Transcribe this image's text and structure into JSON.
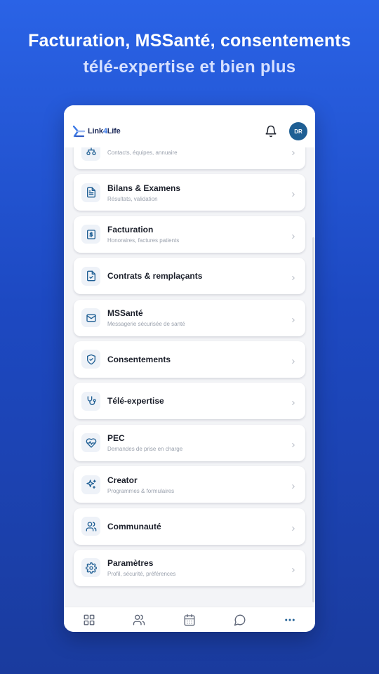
{
  "promo": {
    "headline": "Facturation, MSSanté, consentements",
    "subline": "télé-expertise et bien plus"
  },
  "app": {
    "logo_prefix": "Link",
    "logo_four": "4",
    "logo_suffix": "Life",
    "avatar_initials": "DR",
    "accent": "#1f5f94"
  },
  "menu": [
    {
      "title": "",
      "subtitle": "Contacts, équipes, annuaire",
      "icon": "org-icon"
    },
    {
      "title": "Bilans & Examens",
      "subtitle": "Résultats, validation",
      "icon": "document-icon"
    },
    {
      "title": "Facturation",
      "subtitle": "Honoraires, factures patients",
      "icon": "invoice-icon"
    },
    {
      "title": "Contrats & remplaçants",
      "subtitle": "",
      "icon": "contract-icon"
    },
    {
      "title": "MSSanté",
      "subtitle": "Messagerie sécurisée de santé",
      "icon": "mail-icon"
    },
    {
      "title": "Consentements",
      "subtitle": "",
      "icon": "shield-check-icon"
    },
    {
      "title": "Télé-expertise",
      "subtitle": "",
      "icon": "stethoscope-icon"
    },
    {
      "title": "PEC",
      "subtitle": "Demandes de prise en charge",
      "icon": "heart-pulse-icon"
    },
    {
      "title": "Creator",
      "subtitle": "Programmes & formulaires",
      "icon": "sparkles-icon"
    },
    {
      "title": "Communauté",
      "subtitle": "",
      "icon": "users-icon"
    },
    {
      "title": "Paramètres",
      "subtitle": "Profil, sécurité, préférences",
      "icon": "gear-icon"
    }
  ],
  "bottom_nav": [
    {
      "icon": "grid-icon"
    },
    {
      "icon": "patients-icon"
    },
    {
      "icon": "calendar-icon"
    },
    {
      "icon": "chat-icon"
    },
    {
      "icon": "more-icon",
      "active": true
    }
  ]
}
